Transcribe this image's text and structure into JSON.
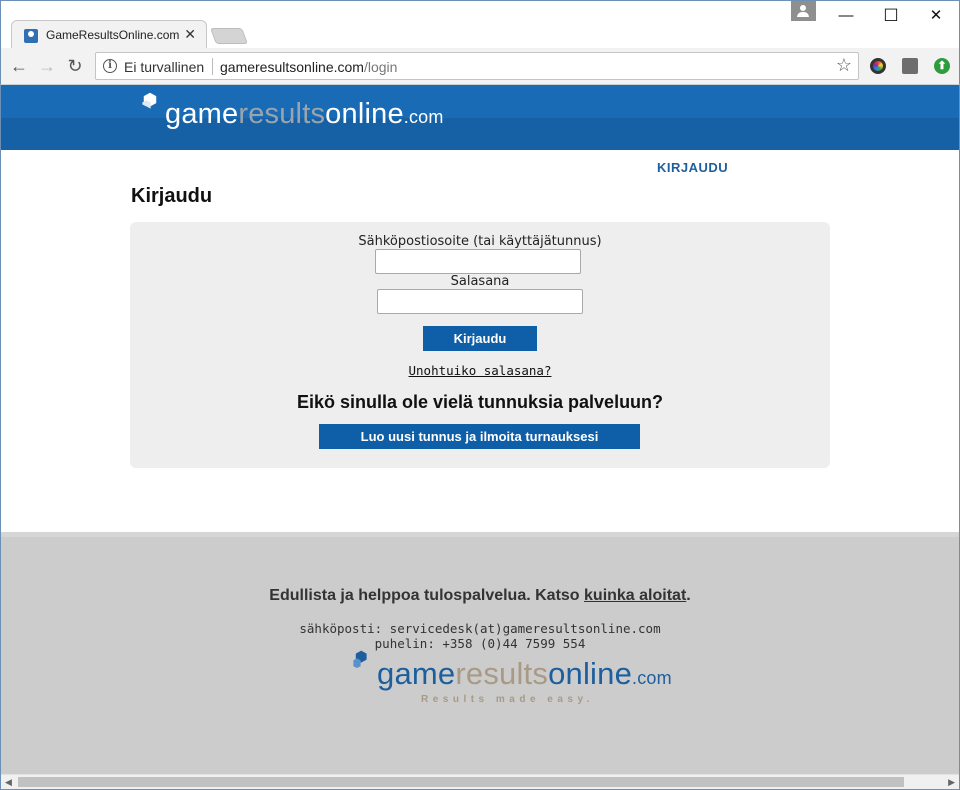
{
  "browser": {
    "tab_title": "GameResultsOnline.com",
    "tab_close_glyph": "✕",
    "window_controls": {
      "minimize": "—",
      "maximize": "☐",
      "close": "✕"
    },
    "nav": {
      "back": "←",
      "forward": "→",
      "reload": "↻"
    },
    "address_bar": {
      "security_label": "Ei turvallinen",
      "url_host": "gameresultsonline.com",
      "url_path": "/login"
    },
    "icons": [
      "info-icon",
      "star-icon",
      "color-wheel-extension-icon",
      "shopping-bag-extension-icon",
      "upload-extension-icon"
    ]
  },
  "site": {
    "logo": {
      "part1": "game",
      "part2": "results",
      "part3": "online",
      "tld": ".com"
    },
    "colors": {
      "brand_blue": "#1660a6",
      "button_blue": "#0f5ea8",
      "logo_grey": "#9aa4ad",
      "panel_bg": "#eeeeee",
      "footer_bg": "#cccccc"
    }
  },
  "nav": {
    "login_link": "KIRJAUDU"
  },
  "login": {
    "heading": "Kirjaudu",
    "email_label": "Sähköpostiosoite (tai käyttäjätunnus)",
    "email_value": "",
    "password_label": "Salasana",
    "password_value": "",
    "submit_label": "Kirjaudu",
    "forgot_link": "Unohtuiko salasana?",
    "register_heading": "Eikö sinulla ole vielä tunnuksia palveluun?",
    "register_button": "Luo uusi tunnus ja ilmoita turnauksesi"
  },
  "footer": {
    "tagline_prefix": "Edullista ja helppoa tulospalvelua. Katso ",
    "tagline_link": "kuinka aloitat",
    "tagline_suffix": ".",
    "email_line": "sähköposti: servicedesk(at)gameresultsonline.com",
    "phone_line": "puhelin: +358 (0)44 7599 554",
    "logo": {
      "part1": "game",
      "part2": "results",
      "part3": "online",
      "tld": ".com"
    },
    "slogan": "Results made easy."
  }
}
